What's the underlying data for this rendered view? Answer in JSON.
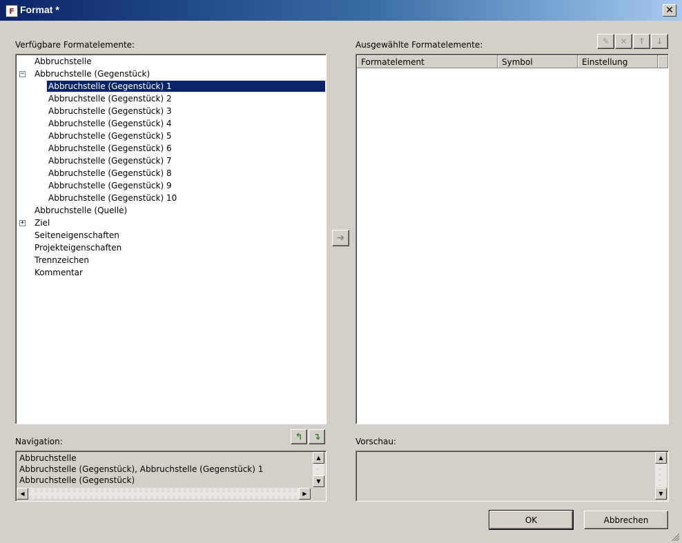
{
  "window": {
    "title": "Format *",
    "close_symbol": "✕"
  },
  "left_panel": {
    "label": "Verfügbare Formatelemente:",
    "tree": [
      {
        "text": "Abbruchstelle",
        "level": 0,
        "expander": "",
        "selected": false
      },
      {
        "text": "Abbruchstelle (Gegenstück)",
        "level": 0,
        "expander": "−",
        "selected": false
      },
      {
        "text": "Abbruchstelle (Gegenstück) 1",
        "level": 1,
        "expander": "",
        "selected": true
      },
      {
        "text": "Abbruchstelle (Gegenstück) 2",
        "level": 1,
        "expander": "",
        "selected": false
      },
      {
        "text": "Abbruchstelle (Gegenstück) 3",
        "level": 1,
        "expander": "",
        "selected": false
      },
      {
        "text": "Abbruchstelle (Gegenstück) 4",
        "level": 1,
        "expander": "",
        "selected": false
      },
      {
        "text": "Abbruchstelle (Gegenstück) 5",
        "level": 1,
        "expander": "",
        "selected": false
      },
      {
        "text": "Abbruchstelle (Gegenstück) 6",
        "level": 1,
        "expander": "",
        "selected": false
      },
      {
        "text": "Abbruchstelle (Gegenstück) 7",
        "level": 1,
        "expander": "",
        "selected": false
      },
      {
        "text": "Abbruchstelle (Gegenstück) 8",
        "level": 1,
        "expander": "",
        "selected": false
      },
      {
        "text": "Abbruchstelle (Gegenstück) 9",
        "level": 1,
        "expander": "",
        "selected": false
      },
      {
        "text": "Abbruchstelle (Gegenstück) 10",
        "level": 1,
        "expander": "",
        "selected": false
      },
      {
        "text": "Abbruchstelle (Quelle)",
        "level": 0,
        "expander": "",
        "selected": false
      },
      {
        "text": "Ziel",
        "level": 0,
        "expander": "+",
        "selected": false
      },
      {
        "text": "Seiteneigenschaften",
        "level": 0,
        "expander": "",
        "selected": false
      },
      {
        "text": "Projekteigenschaften",
        "level": 0,
        "expander": "",
        "selected": false
      },
      {
        "text": "Trennzeichen",
        "level": 0,
        "expander": "",
        "selected": false
      },
      {
        "text": "Kommentar",
        "level": 0,
        "expander": "",
        "selected": false
      }
    ]
  },
  "right_panel": {
    "label": "Ausgewählte Formatelemente:",
    "columns": [
      "Formatelement",
      "Symbol",
      "Einstellung"
    ],
    "toolbar": [
      "pencil-icon",
      "delete-icon",
      "move-up-icon",
      "move-down-icon"
    ],
    "toolbar_glyphs": [
      "✎",
      "✕",
      "↑",
      "↓"
    ]
  },
  "add_button_glyph": "➜",
  "navigation": {
    "label": "Navigation:",
    "lines": [
      "Abbruchstelle",
      "Abbruchstelle (Gegenstück), Abbruchstelle (Gegenstück) 1",
      "Abbruchstelle (Gegenstück)"
    ],
    "button_glyphs": [
      "↰",
      "↴"
    ]
  },
  "preview": {
    "label": "Vorschau:"
  },
  "buttons": {
    "ok": "OK",
    "cancel": "Abbrechen"
  },
  "scroll_glyphs": {
    "up": "▲",
    "down": "▼",
    "left": "◀",
    "right": "▶"
  }
}
